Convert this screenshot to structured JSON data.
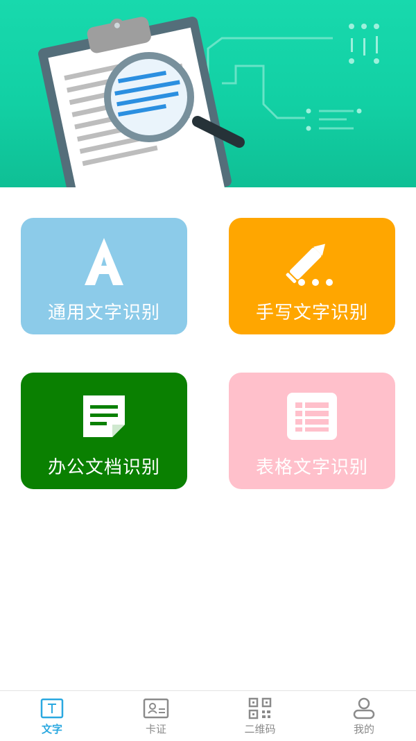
{
  "banner": {
    "illustration": "clipboard-with-magnifier"
  },
  "tiles": [
    {
      "label": "通用文字识别",
      "icon": "letter-a-icon",
      "color": "#8ccbe9"
    },
    {
      "label": "手写文字识别",
      "icon": "pencil-icon",
      "color": "#ffa600"
    },
    {
      "label": "办公文档识别",
      "icon": "document-icon",
      "color": "#0a8001"
    },
    {
      "label": "表格文字识别",
      "icon": "table-icon",
      "color": "#ffc0cb"
    }
  ],
  "tabs": [
    {
      "label": "文字",
      "icon": "text-icon",
      "active": true
    },
    {
      "label": "卡证",
      "icon": "id-card-icon",
      "active": false
    },
    {
      "label": "二维码",
      "icon": "qr-code-icon",
      "active": false
    },
    {
      "label": "我的",
      "icon": "user-icon",
      "active": false
    }
  ],
  "colors": {
    "banner": "#18d9ad",
    "active_tab": "#2aa8e0",
    "inactive_tab": "#8a8a8a"
  }
}
